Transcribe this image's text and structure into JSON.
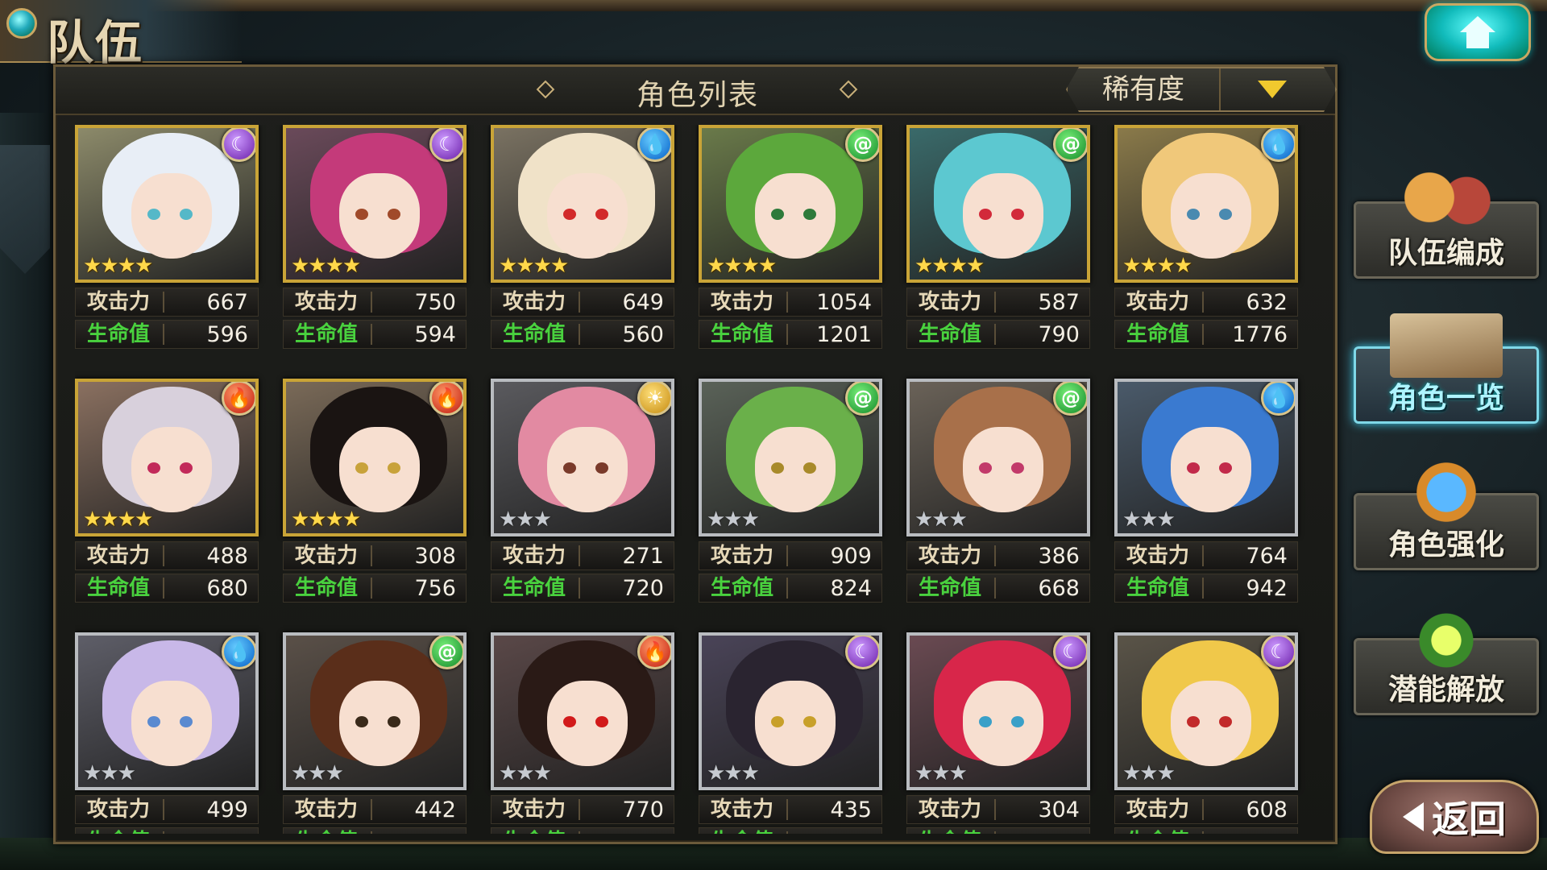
{
  "header": {
    "title": "队伍",
    "home_icon": "home-icon"
  },
  "panel": {
    "title": "角色列表",
    "sort_label": "稀有度"
  },
  "labels": {
    "atk": "攻击力",
    "hp": "生命值"
  },
  "characters": [
    {
      "element": "dark",
      "rarity": "gold",
      "stars": 4,
      "atk": "667",
      "hp": "596",
      "hair": "#e8eef6",
      "eye": "#55b8c8",
      "bg": "#8c8a6a"
    },
    {
      "element": "dark",
      "rarity": "gold",
      "stars": 4,
      "atk": "750",
      "hp": "594",
      "hair": "#c43a7a",
      "eye": "#a04a2a",
      "bg": "#6a4a5a"
    },
    {
      "element": "water",
      "rarity": "gold",
      "stars": 4,
      "atk": "649",
      "hp": "560",
      "hair": "#f0e2c8",
      "eye": "#d22a2a",
      "bg": "#7a7262"
    },
    {
      "element": "wind",
      "rarity": "gold",
      "stars": 4,
      "atk": "1054",
      "hp": "1201",
      "hair": "#5ca83c",
      "eye": "#2e7a3a",
      "bg": "#6a7a4a"
    },
    {
      "element": "wind",
      "rarity": "gold",
      "stars": 4,
      "atk": "587",
      "hp": "790",
      "hair": "#5cc8d0",
      "eye": "#d22a3a",
      "bg": "#3a6a6a"
    },
    {
      "element": "water",
      "rarity": "gold",
      "stars": 4,
      "atk": "632",
      "hp": "1776",
      "hair": "#f0c87a",
      "eye": "#4a8ab0",
      "bg": "#8a7a4a"
    },
    {
      "element": "fire",
      "rarity": "gold",
      "stars": 4,
      "atk": "488",
      "hp": "680",
      "hair": "#d8d0dc",
      "eye": "#c22a5a",
      "bg": "#8a7060"
    },
    {
      "element": "fire",
      "rarity": "gold",
      "stars": 4,
      "atk": "308",
      "hp": "756",
      "hair": "#1a1412",
      "eye": "#c8a23a",
      "bg": "#7a6a58"
    },
    {
      "element": "light",
      "rarity": "silver",
      "stars": 3,
      "atk": "271",
      "hp": "720",
      "hair": "#e28aa2",
      "eye": "#7a3a2a",
      "bg": "#5a5a5e"
    },
    {
      "element": "wind",
      "rarity": "silver",
      "stars": 3,
      "atk": "909",
      "hp": "824",
      "hair": "#6ab04a",
      "eye": "#a88a2a",
      "bg": "#5a6258"
    },
    {
      "element": "wind",
      "rarity": "silver",
      "stars": 3,
      "atk": "386",
      "hp": "668",
      "hair": "#a8704a",
      "eye": "#c23a6a",
      "bg": "#6a6258"
    },
    {
      "element": "water",
      "rarity": "silver",
      "stars": 3,
      "atk": "764",
      "hp": "942",
      "hair": "#3a7ad0",
      "eye": "#c22a4a",
      "bg": "#4a5a6a"
    },
    {
      "element": "water",
      "rarity": "silver",
      "stars": 3,
      "atk": "499",
      "hp": "",
      "hair": "#c8b8e8",
      "eye": "#5a8ad0",
      "bg": "#5e5e68"
    },
    {
      "element": "wind",
      "rarity": "silver",
      "stars": 3,
      "atk": "442",
      "hp": "",
      "hair": "#5a2e1a",
      "eye": "#3a2a1a",
      "bg": "#5a5048"
    },
    {
      "element": "fire",
      "rarity": "silver",
      "stars": 3,
      "atk": "770",
      "hp": "",
      "hair": "#2a1a16",
      "eye": "#d21a1a",
      "bg": "#5a4848"
    },
    {
      "element": "dark",
      "rarity": "silver",
      "stars": 3,
      "atk": "435",
      "hp": "",
      "hair": "#2a2430",
      "eye": "#c8a02a",
      "bg": "#4a4458"
    },
    {
      "element": "dark",
      "rarity": "silver",
      "stars": 3,
      "atk": "304",
      "hp": "",
      "hair": "#d8264a",
      "eye": "#3aa0c8",
      "bg": "#6a4a52"
    },
    {
      "element": "dark",
      "rarity": "silver",
      "stars": 3,
      "atk": "608",
      "hp": "",
      "hair": "#f0c84a",
      "eye": "#c22a2a",
      "bg": "#5a5448"
    }
  ],
  "side_menu": [
    {
      "label": "队伍编成",
      "active": false,
      "art": "team-members-icon"
    },
    {
      "label": "角色一览",
      "active": true,
      "art": "book-icon"
    },
    {
      "label": "角色强化",
      "active": false,
      "art": "card-upgrade-icon"
    },
    {
      "label": "潜能解放",
      "active": false,
      "art": "orb-icon"
    }
  ],
  "back_label": "返回",
  "colors": {
    "gold_frame": "#c9a437",
    "silver_frame": "#b9bcc0",
    "hp_label": "#49d23e",
    "accent_cyan": "#7fd8e8"
  }
}
